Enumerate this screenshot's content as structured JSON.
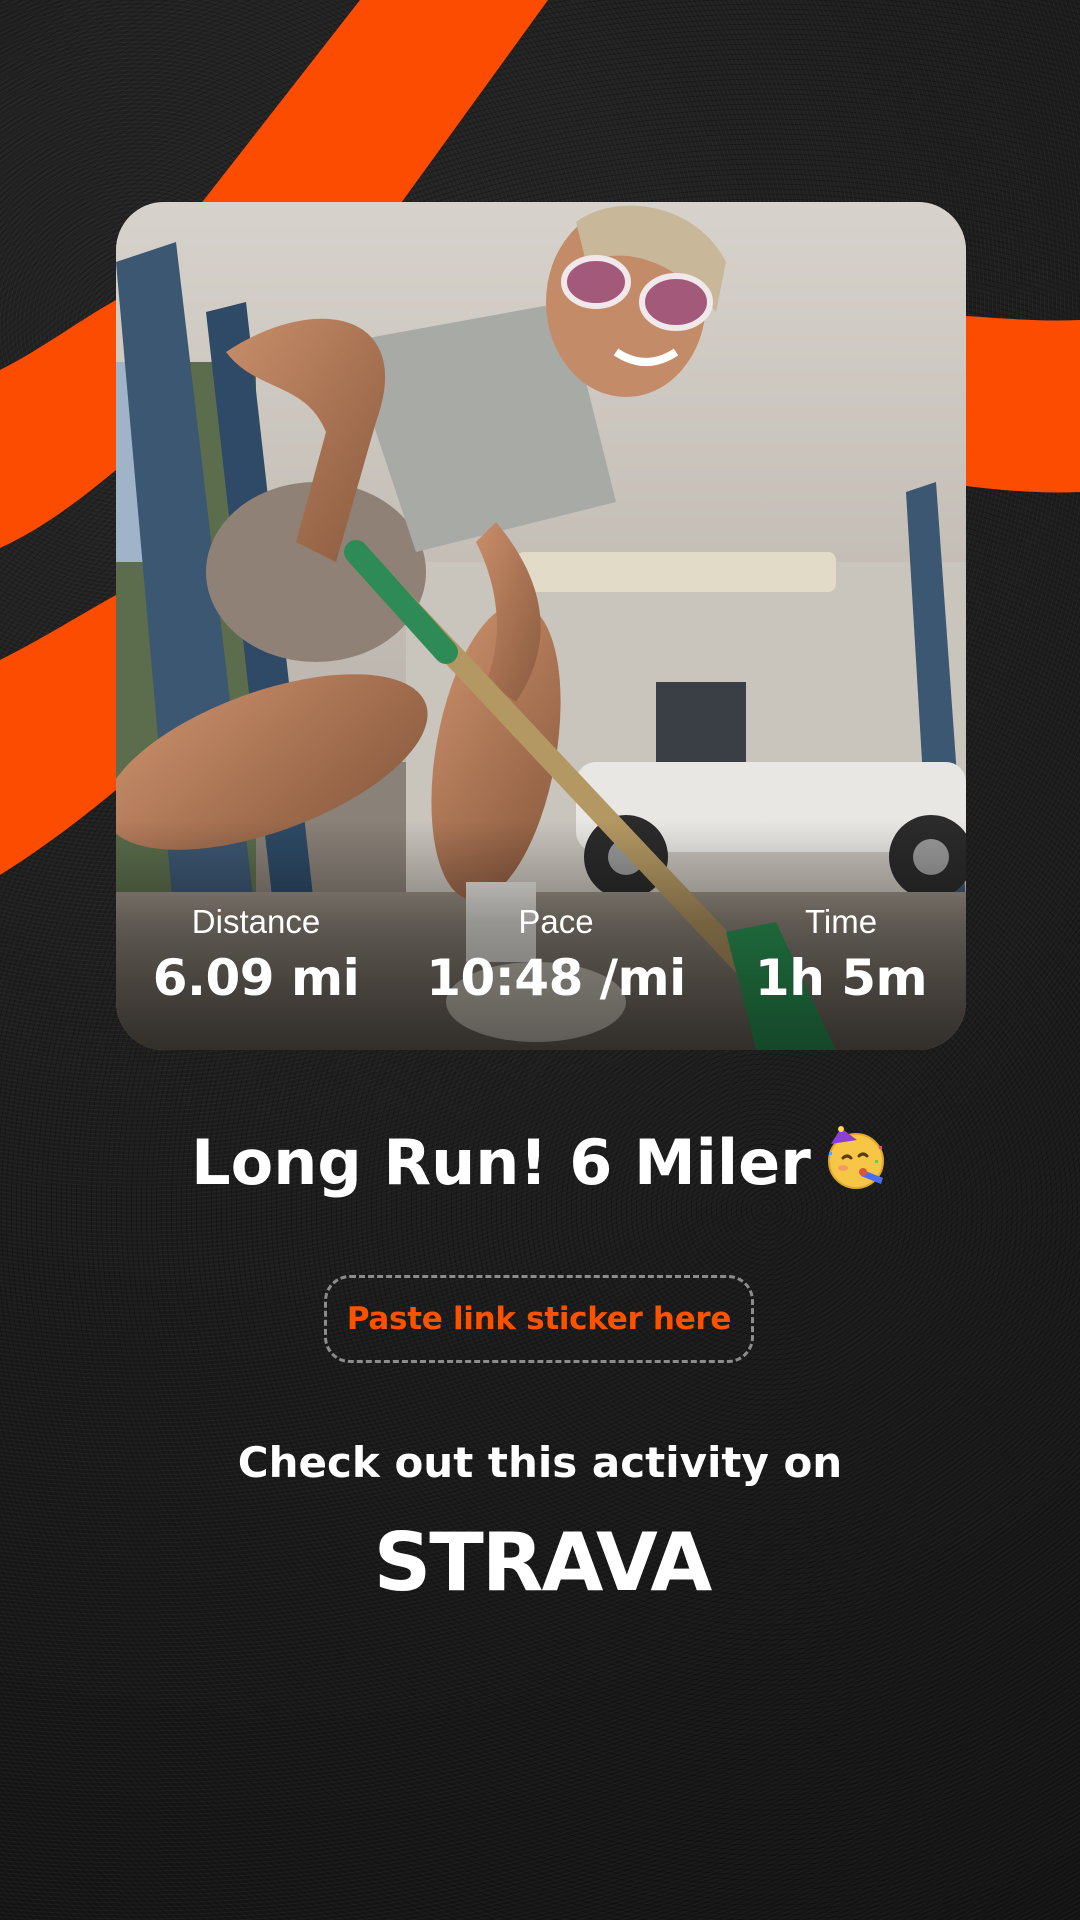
{
  "stats": {
    "distance": {
      "label": "Distance",
      "value": "6.09 mi"
    },
    "pace": {
      "label": "Pace",
      "value": "10:48 /mi"
    },
    "time": {
      "label": "Time",
      "value": "1h 5m"
    }
  },
  "activity": {
    "title": "Long Run! 6 Miler",
    "emoji": "partying-face-icon"
  },
  "sticker_placeholder": "Paste link sticker here",
  "cta": "Check out this activity on",
  "brand": {
    "logo_text": "STRAVA",
    "accent_color": "#fc5200",
    "background_color": "#1c1c1c"
  },
  "photo": {
    "description_icon": "runner-photo"
  }
}
